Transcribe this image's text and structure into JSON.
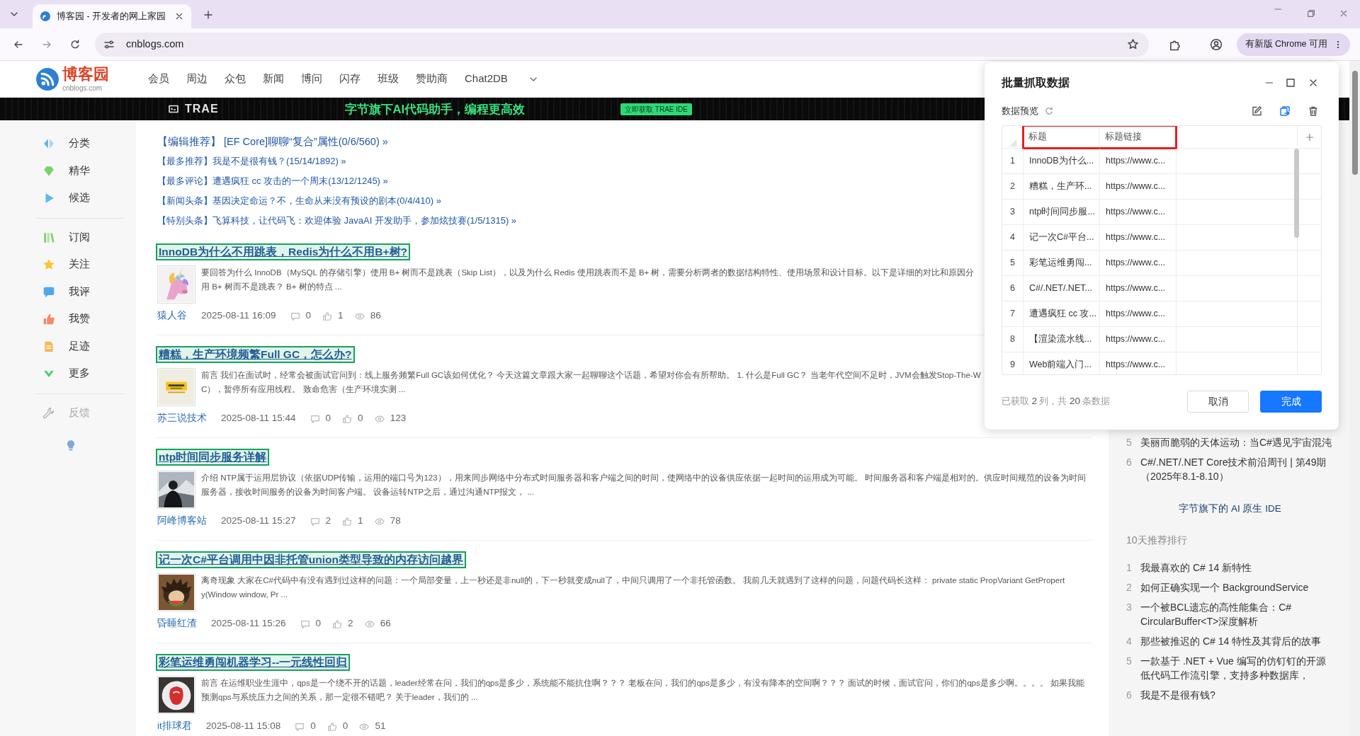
{
  "browser": {
    "tab_title": "博客园 - 开发者的网上家园",
    "url": "cnblogs.com",
    "update_notice": "有新版 Chrome 可用"
  },
  "site": {
    "logo_title": "博客园",
    "logo_domain": "cnblogs.com",
    "nav": [
      "会员",
      "周边",
      "众包",
      "新闻",
      "博问",
      "闪存",
      "班级",
      "赞助商",
      "Chat2DB"
    ]
  },
  "banner": {
    "brand": "TRAE",
    "slogan": "字节旗下AI代码助手，编程更高效",
    "cta": "立即获取 TRAE IDE"
  },
  "sidebar": {
    "groups": [
      [
        {
          "label": "分类",
          "muted": false
        },
        {
          "label": "精华",
          "muted": false
        },
        {
          "label": "候选",
          "muted": false
        }
      ],
      [
        {
          "label": "订阅",
          "muted": false
        },
        {
          "label": "关注",
          "muted": false
        },
        {
          "label": "我评",
          "muted": false
        },
        {
          "label": "我赞",
          "muted": false
        },
        {
          "label": "足迹",
          "muted": false
        },
        {
          "label": "更多",
          "muted": false
        }
      ],
      [
        {
          "label": "反馈",
          "muted": true
        }
      ]
    ]
  },
  "headlines": [
    {
      "text": "【编辑推荐】 [EF Core]聊聊“复合”属性(0/6/560) »",
      "featured": true
    },
    {
      "text": "【最多推荐】我是不是很有钱？(15/14/1892) »",
      "featured": false
    },
    {
      "text": "【最多评论】遭遇疯狂 cc 攻击的一个周末(13/12/1245) »",
      "featured": false
    },
    {
      "text": "【新闻头条】基因决定命运？不，生命从来没有预设的剧本(0/4/410) »",
      "featured": false
    },
    {
      "text": "【特别头条】飞算科技，让代码飞：欢迎体验 JavaAI 开发助手，参加炫技赛(1/5/1315) »",
      "featured": false
    }
  ],
  "posts": [
    {
      "title": "InnoDB为什么不用跳表，Redis为什么不用B+树?",
      "highlighted": true,
      "summary_lines": [
        "要回答为什么 InnoDB（MySQL 的存储引擎）使用 B+ 树而不是跳表（Skip List），以及为什么 Redis 使用跳表而不是 B+ 树，需要分析两者的数据结构特性、使用场景和设计目标。以下是详细的对比和原因分",
        "用 B+ 树而不是跳表？ B+ 树的特点 ..."
      ],
      "author": "猿人谷",
      "date": "2025-08-11 16:09",
      "comments": "0",
      "likes": "1",
      "views": "86"
    },
    {
      "title": "糟糕，生产环境频繁Full GC，怎么办?",
      "highlighted": true,
      "summary_lines": [
        "前言 我们在面试时，经常会被面试官问到：线上服务频繁Full GC该如何优化？ 今天这篇文章跟大家一起聊聊这个话题，希望对你会有所帮助。 1. 什么是Full GC？ 当老年代空间不足时，JVM会触发Stop-The-W",
        "C），暂停所有应用线程。 致命危害（生产环境实测 ..."
      ],
      "author": "苏三说技术",
      "date": "2025-08-11 15:44",
      "comments": "0",
      "likes": "0",
      "views": "123"
    },
    {
      "title": "ntp时间同步服务详解",
      "highlighted": true,
      "summary_lines": [
        "介绍 NTP属于运用层协议（依据UDP传输，运用的端口号为123），用来同步网络中分布式时间服务器和客户端之间的时间，使网络中的设备供应依据一起时间的运用成为可能。 时间服务器和客户端是相对的。供应时间规范的设备为时间",
        "服务器，接收时间服务的设备为时间客户端。 设备运转NTP之后，通过沟通NTP报文， ..."
      ],
      "author": "阿峰博客站",
      "date": "2025-08-11 15:27",
      "comments": "2",
      "likes": "1",
      "views": "78"
    },
    {
      "title": "记一次C#平台调用中因非托管union类型导致的内存访问越界",
      "highlighted": true,
      "summary_lines": [
        "离奇现象 大家在C#代码中有没有遇到过这样的问题：一个局部变量，上一秒还是非null的，下一秒就变成null了，中间只调用了一个非托管函数。 我前几天就遇到了这样的问题，问题代码长这样： private static PropVariant GetPropert",
        "y(Window window, Pr ..."
      ],
      "author": "昏睡红渣",
      "date": "2025-08-11 15:26",
      "comments": "0",
      "likes": "2",
      "views": "66"
    },
    {
      "title": "彩笔运维勇闯机器学习--一元线性回归",
      "highlighted": true,
      "summary_lines": [
        "前言 在运维职业生涯中，qps是一个绕不开的话题，leader经常在问，我们的qps是多少，系统能不能抗住啊？？？ 老板在问，我们的qps是多少，有没有降本的空间啊？？？ 面试的时候，面试官问，你们的qps是多少啊。。。。 如果我能",
        "预测qps与系统压力之间的关系，那一定很不错吧？ 关于leader，我们的 ..."
      ],
      "author": "it排球君",
      "date": "2025-08-11 15:08",
      "comments": "0",
      "likes": "0",
      "views": "51"
    }
  ],
  "right_sidebar": {
    "top_list": [
      {
        "rank": "5",
        "title": "美丽而脆弱的天体运动：当C#遇见宇宙混沌"
      },
      {
        "rank": "6",
        "title": "C#/.NET/.NET Core技术前沿周刊 | 第49期（2025年8.1-8.10）"
      }
    ],
    "promo": "字节旗下的 AI 原生 IDE",
    "ranking_title": "10天推荐排行",
    "ranking": [
      {
        "rank": "1",
        "title": "我最喜欢的 C# 14 新特性"
      },
      {
        "rank": "2",
        "title": "如何正确实现一个 BackgroundService"
      },
      {
        "rank": "3",
        "title": "一个被BCL遗忘的高性能集合：C# CircularBuffer<T>深度解析"
      },
      {
        "rank": "4",
        "title": "那些被推迟的 C# 14 特性及其背后的故事"
      },
      {
        "rank": "5",
        "title": "一款基于 .NET + Vue 编写的仿钉钉的开源低代码工作流引擎，支持多种数据库，"
      },
      {
        "rank": "6",
        "title": "我是不是很有钱?"
      }
    ]
  },
  "dialog": {
    "title": "批量抓取数据",
    "preview_label": "数据预览",
    "table": {
      "header_highlighted": true,
      "columns": [
        "标题",
        "标题链接"
      ],
      "rows": [
        {
          "index": "1",
          "cells": [
            "InnoDB为什么...",
            "https://www.c..."
          ]
        },
        {
          "index": "2",
          "cells": [
            "糟糕，生产环...",
            "https://www.c..."
          ]
        },
        {
          "index": "3",
          "cells": [
            "ntp时间同步服...",
            "https://www.c..."
          ]
        },
        {
          "index": "4",
          "cells": [
            "记一次C#平台...",
            "https://www.c..."
          ]
        },
        {
          "index": "5",
          "cells": [
            "彩笔运维勇闯...",
            "https://www.c..."
          ]
        },
        {
          "index": "6",
          "cells": [
            "C#/.NET/.NET...",
            "https://www.c..."
          ]
        },
        {
          "index": "7",
          "cells": [
            "遭遇疯狂 cc 攻...",
            "https://www.c..."
          ]
        },
        {
          "index": "8",
          "cells": [
            "【渲染流水线...",
            "https://www.c..."
          ]
        },
        {
          "index": "9",
          "cells": [
            "Web前端入门...",
            "https://www.c..."
          ]
        }
      ]
    },
    "summary": "已获取 **2** 列，共 **20** 条数据",
    "buttons": [
      {
        "label": "取消",
        "primary": false
      },
      {
        "label": "完成",
        "primary": true
      }
    ]
  }
}
